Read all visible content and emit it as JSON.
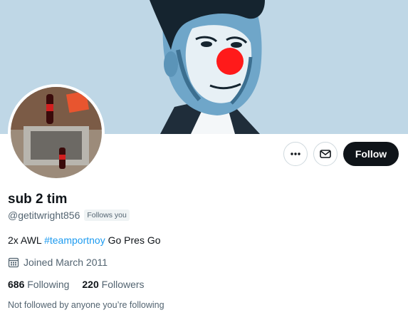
{
  "profile": {
    "display_name": "sub 2 tim",
    "handle": "@getitwright856",
    "follows_you_badge": "Follows you",
    "bio": {
      "prefix": "2x AWL ",
      "hashtag": "#teamportnoy",
      "suffix": " Go Pres Go"
    },
    "joined": "Joined March 2011",
    "following_count": "686",
    "following_label": "Following",
    "followers_count": "220",
    "followers_label": "Followers",
    "not_followed_note": "Not followed by anyone you’re following"
  },
  "actions": {
    "more_icon": "more-horizontal-icon",
    "message_icon": "mail-icon",
    "follow_label": "Follow"
  },
  "icons": {
    "joined": "calendar-icon"
  },
  "colors": {
    "banner_bg": "#bfd7e6",
    "clown_nose": "#ff1a1a",
    "link": "#1d9bf0",
    "follow_bg": "#0f1419"
  }
}
